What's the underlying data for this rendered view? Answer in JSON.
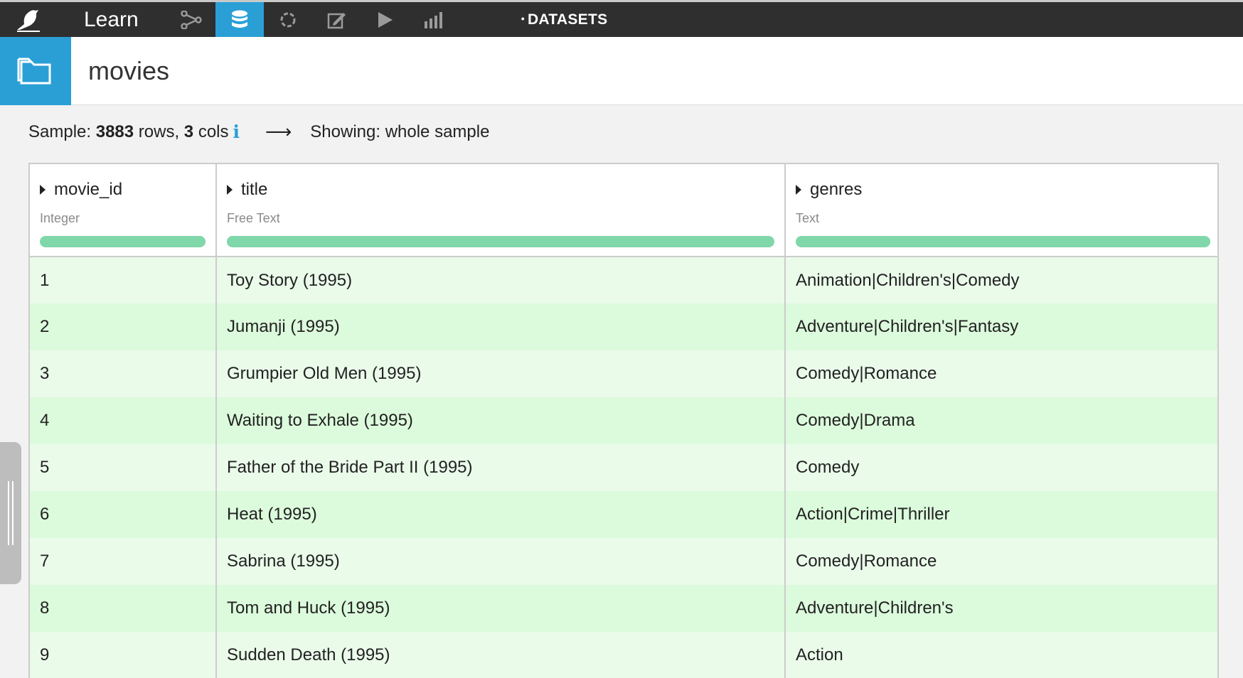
{
  "nav": {
    "learn_label": "Learn",
    "icons": [
      "bird-logo-icon",
      "flow-icon",
      "datasets-icon",
      "recipes-icon",
      "notebook-icon",
      "run-icon",
      "chart-icon"
    ],
    "breadcrumb": "DATASETS",
    "breadcrumb_prefix": "•",
    "active_color": "#2a9fd6"
  },
  "header": {
    "title": "movies",
    "icon": "folder-icon"
  },
  "sample": {
    "label_prefix": "Sample:",
    "rows_count": "3883",
    "rows_word": "rows,",
    "cols_count": "3",
    "cols_word": "cols",
    "info": "i",
    "arrow": "⟶",
    "showing": "Showing: whole sample"
  },
  "table": {
    "columns": [
      {
        "name": "movie_id",
        "type": "Integer",
        "quality": 1.0
      },
      {
        "name": "title",
        "type": "Free Text",
        "quality": 1.0
      },
      {
        "name": "genres",
        "type": "Text",
        "quality": 1.0
      }
    ],
    "rows": [
      [
        "1",
        "Toy Story (1995)",
        "Animation|Children's|Comedy"
      ],
      [
        "2",
        "Jumanji (1995)",
        "Adventure|Children's|Fantasy"
      ],
      [
        "3",
        "Grumpier Old Men (1995)",
        "Comedy|Romance"
      ],
      [
        "4",
        "Waiting to Exhale (1995)",
        "Comedy|Drama"
      ],
      [
        "5",
        "Father of the Bride Part II (1995)",
        "Comedy"
      ],
      [
        "6",
        "Heat (1995)",
        "Action|Crime|Thriller"
      ],
      [
        "7",
        "Sabrina (1995)",
        "Comedy|Romance"
      ],
      [
        "8",
        "Tom and Huck (1995)",
        "Adventure|Children's"
      ],
      [
        "9",
        "Sudden Death (1995)",
        "Action"
      ]
    ],
    "quality_color": "#7fd7aa",
    "row_colors": [
      "#eafbea",
      "#dcfadc"
    ]
  }
}
